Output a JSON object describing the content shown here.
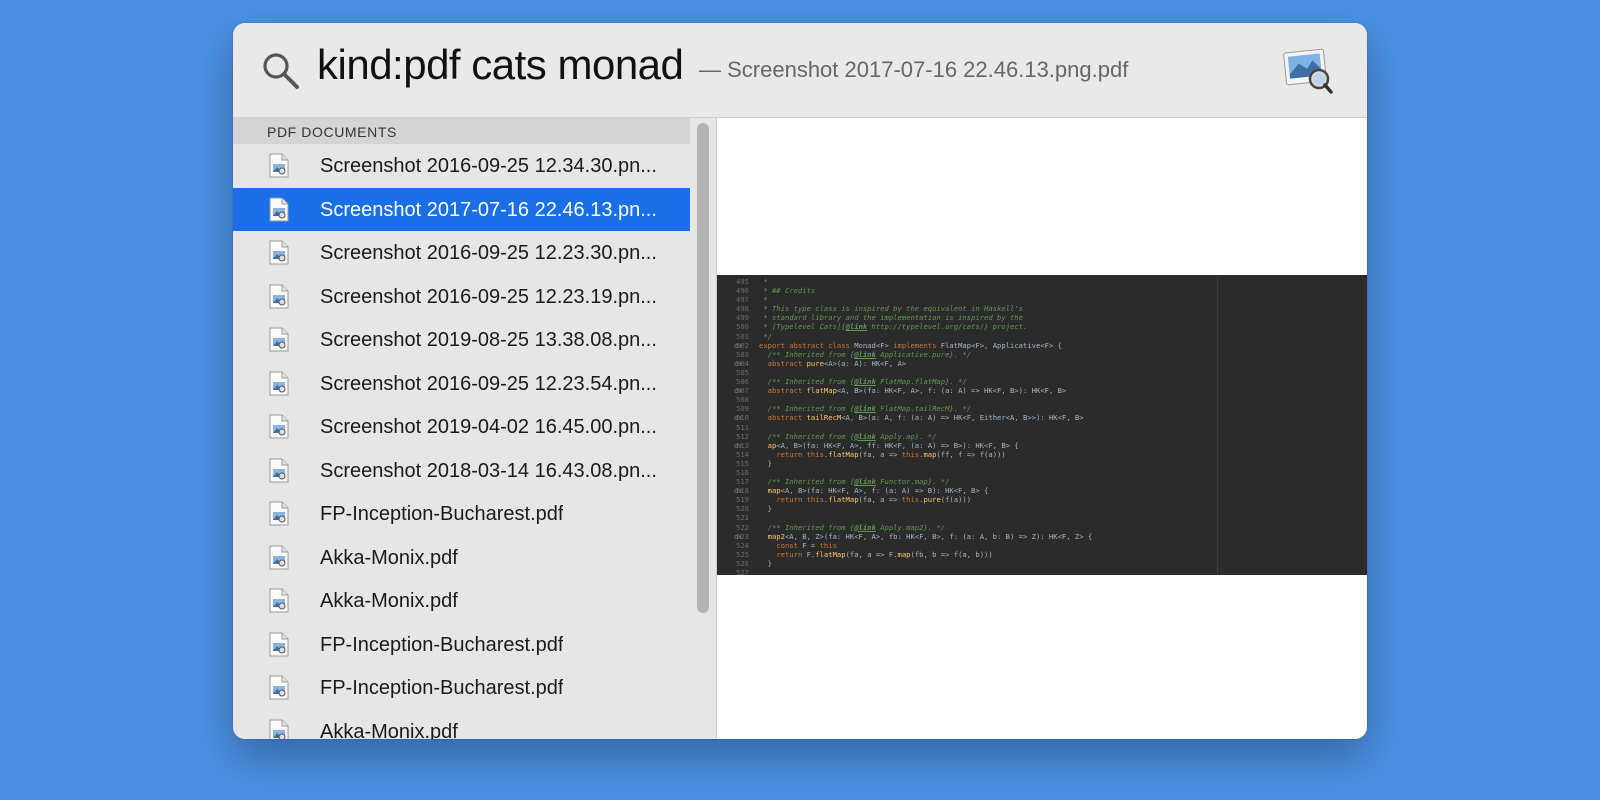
{
  "search": {
    "query": "kind:pdf cats monad",
    "suffix": "— Screenshot 2017-07-16 22.46.13.png.pdf"
  },
  "results": {
    "section_title": "PDF DOCUMENTS",
    "items": [
      {
        "label": "Screenshot 2016-09-25 12.34.30.pn..."
      },
      {
        "label": "Screenshot 2017-07-16 22.46.13.pn...",
        "selected": true
      },
      {
        "label": "Screenshot 2016-09-25 12.23.30.pn..."
      },
      {
        "label": "Screenshot 2016-09-25 12.23.19.pn..."
      },
      {
        "label": "Screenshot 2019-08-25 13.38.08.pn..."
      },
      {
        "label": "Screenshot 2016-09-25 12.23.54.pn..."
      },
      {
        "label": "Screenshot 2019-04-02 16.45.00.pn..."
      },
      {
        "label": "Screenshot 2018-03-14 16.43.08.pn..."
      },
      {
        "label": "FP-Inception-Bucharest.pdf"
      },
      {
        "label": "Akka-Monix.pdf"
      },
      {
        "label": "Akka-Monix.pdf"
      },
      {
        "label": "FP-Inception-Bucharest.pdf"
      },
      {
        "label": "FP-Inception-Bucharest.pdf"
      },
      {
        "label": "Akka-Monix.pdf"
      }
    ]
  },
  "preview": {
    "line_numbers": [
      "495",
      "496",
      "497",
      "498",
      "499",
      "500",
      "501",
      "502",
      "503",
      "504",
      "505",
      "506",
      "507",
      "508",
      "509",
      "510",
      "511",
      "512",
      "513",
      "514",
      "515",
      "516",
      "517",
      "518",
      "519",
      "520",
      "521",
      "522",
      "523",
      "524",
      "525",
      "526",
      "527"
    ],
    "code_lines": [
      " *",
      " * ## Credits",
      " *",
      " * This type class is inspired by the equivalent in Haskell's",
      " * standard library and the implementation is inspired by the",
      " * [Typelevel Cats]{@link http://typelevel.org/cats/} project.",
      " */",
      "export abstract class Monad<F> implements FlatMap<F>, Applicative<F> {",
      "  /** Inherited from {@link Applicative.pure}. */",
      "  abstract pure<A>(a: A): HK<F, A>",
      "",
      "  /** Inherited from {@link FlatMap.flatMap}. */",
      "  abstract flatMap<A, B>(fa: HK<F, A>, f: (a: A) => HK<F, B>): HK<F, B>",
      "",
      "  /** Inherited from {@link FlatMap.tailRecM}. */",
      "  abstract tailRecM<A, B>(a: A, f: (a: A) => HK<F, Either<A, B>>): HK<F, B>",
      "",
      "  /** Inherited from {@link Apply.ap}. */",
      "  ap<A, B>(fa: HK<F, A>, ff: HK<F, (a: A) => B>): HK<F, B> {",
      "    return this.flatMap(fa, a => this.map(ff, f => f(a)))",
      "  }",
      "",
      "  /** Inherited from {@link Functor.map}. */",
      "  map<A, B>(fa: HK<F, A>, f: (a: A) => B): HK<F, B> {",
      "    return this.flatMap(fa, a => this.pure(f(a)))",
      "  }",
      "",
      "  /** Inherited from {@link Apply.map2}. */",
      "  map2<A, B, Z>(fa: HK<F, A>, fb: HK<F, B>, f: (a: A, b: B) => Z): HK<F, Z> {",
      "    const F = this",
      "    return F.flatMap(fa, a => F.map(fb, b => f(a, b)))",
      "  }",
      ""
    ]
  }
}
